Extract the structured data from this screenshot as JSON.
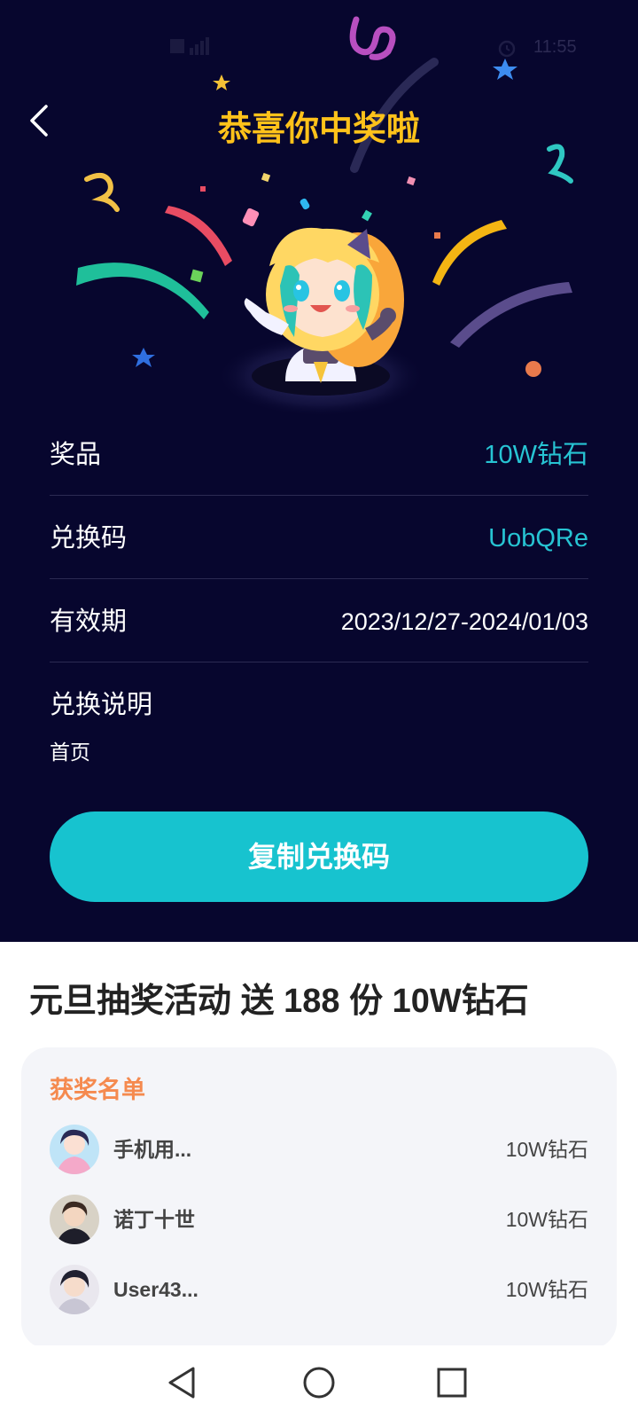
{
  "status_bar": {
    "signal_icon": "cell-signal-icon",
    "alarm_icon": "alarm-icon",
    "time": "11:55"
  },
  "header": {
    "back_icon": "chevron-left-icon",
    "title": "恭喜你中奖啦"
  },
  "prize_info": {
    "prize_label": "奖品",
    "prize_value": "10W钻石",
    "code_label": "兑换码",
    "code_value": "UobQRe",
    "validity_label": "有效期",
    "validity_value": "2023/12/27-2024/01/03",
    "instructions_label": "兑换说明",
    "instructions_text": "首页"
  },
  "actions": {
    "copy_label": "复制兑换码"
  },
  "activity": {
    "title": "元旦抽奖活动 送 188 份 10W钻石"
  },
  "winners": {
    "title": "获奖名单",
    "list": [
      {
        "name": "手机用...",
        "prize": "10W钻石"
      },
      {
        "name": "诺丁十世",
        "prize": "10W钻石"
      },
      {
        "name": "User43...",
        "prize": "10W钻石"
      }
    ]
  },
  "nav": {
    "back_icon": "triangle-back-icon",
    "home_icon": "circle-home-icon",
    "recents_icon": "square-recents-icon"
  },
  "colors": {
    "background_top": "#07062e",
    "title_accent": "#ffc21a",
    "value_accent": "#27c4d3",
    "button": "#17c3cf",
    "winners_title": "#f58a4f"
  }
}
